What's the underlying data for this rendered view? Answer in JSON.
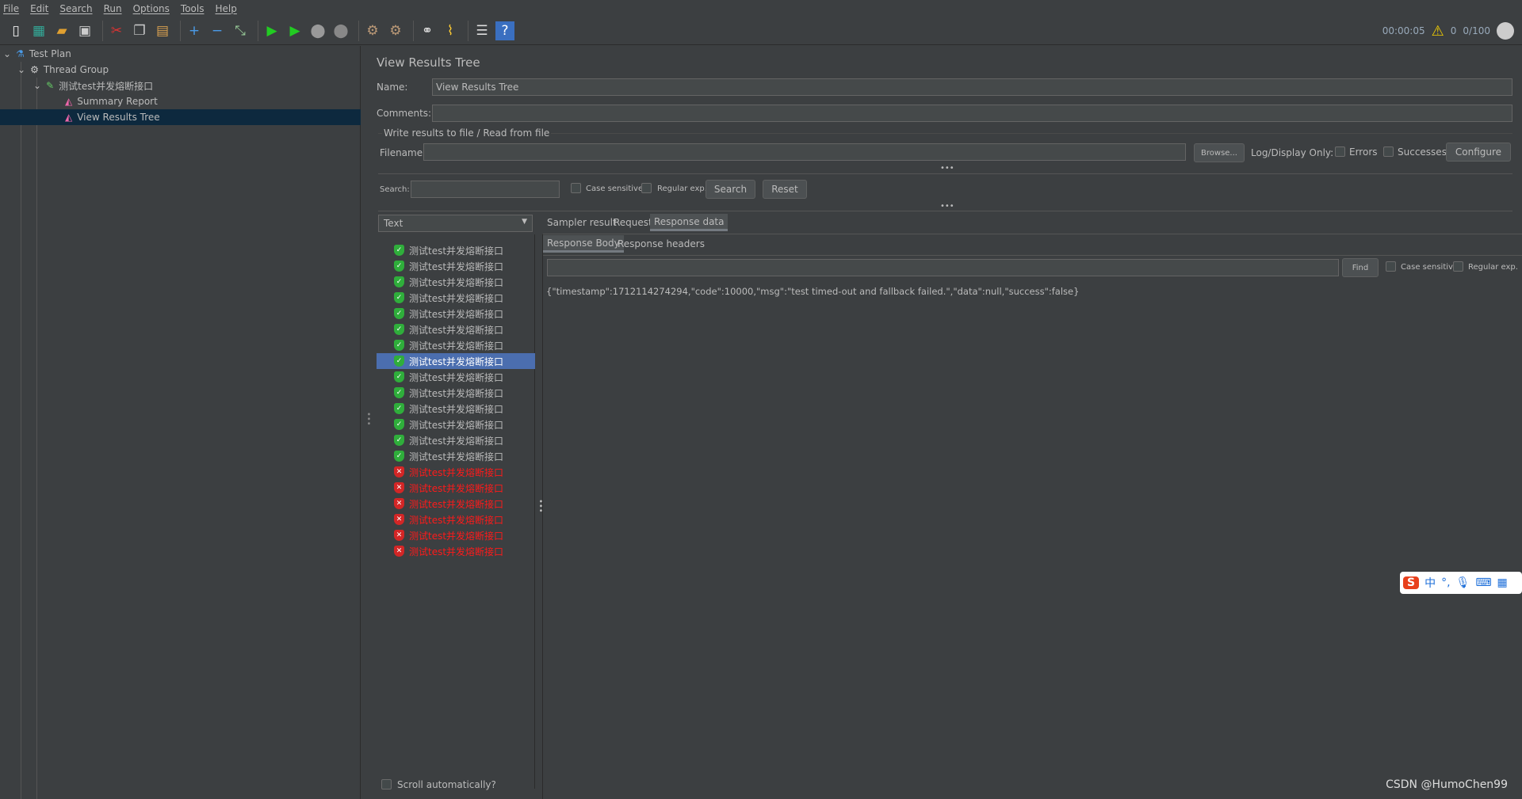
{
  "menu": [
    "File",
    "Edit",
    "Search",
    "Run",
    "Options",
    "Tools",
    "Help"
  ],
  "toolbar": [
    "new-icon",
    "templates-icon",
    "open-icon",
    "save-icon",
    "cut-icon",
    "copy-icon",
    "paste-icon",
    "expand-icon",
    "collapse-icon",
    "toggle-icon",
    "start-icon",
    "start-no-pause-icon",
    "stop-icon",
    "shutdown-icon",
    "clear-icon",
    "clear-all-icon",
    "search-icon",
    "reset-search-icon",
    "function-helper-icon",
    "help-icon"
  ],
  "status": {
    "elapsed": "00:00:05",
    "warnings": "0",
    "threads": "0/100"
  },
  "tree": [
    {
      "label": "Test Plan",
      "icon": "flask-icon"
    },
    {
      "label": "Thread Group",
      "icon": "gear-icon"
    },
    {
      "label": "测试test并发熔断接口",
      "icon": "pipette-icon"
    },
    {
      "label": "Summary Report",
      "icon": "chart-icon"
    },
    {
      "label": "View Results Tree",
      "icon": "chart-icon"
    }
  ],
  "panel": {
    "title": "View Results Tree",
    "name_label": "Name:",
    "name_value": "View Results Tree",
    "comments_label": "Comments:",
    "comments_value": "",
    "group_title": "Write results to file / Read from file",
    "filename_label": "Filename",
    "filename_value": "",
    "browse": "Browse...",
    "log_only": "Log/Display Only:",
    "errors": "Errors",
    "successes": "Successes",
    "configure": "Configure",
    "search_label": "Search:",
    "case_sensitive": "Case sensitive",
    "regular_exp": "Regular exp.",
    "search_btn": "Search",
    "reset_btn": "Reset",
    "renderer": "Text",
    "scroll_auto": "Scroll automatically?"
  },
  "results": {
    "label": "测试test并发熔断接口",
    "statuses": [
      "ok",
      "ok",
      "ok",
      "ok",
      "ok",
      "ok",
      "ok",
      "ok",
      "ok",
      "ok",
      "ok",
      "ok",
      "ok",
      "ok",
      "error",
      "error",
      "error",
      "error",
      "error",
      "error"
    ],
    "selected_index": 7
  },
  "tabs": [
    "Sampler result",
    "Request",
    "Response data"
  ],
  "subtabs": [
    "Response Body",
    "Response headers"
  ],
  "find": {
    "button": "Find",
    "case_sensitive": "Case sensitive",
    "regular_exp": "Regular exp."
  },
  "response_body": "{\"timestamp\":1712114274294,\"code\":10000,\"msg\":\"test timed-out and fallback failed.\",\"data\":null,\"success\":false}",
  "ime": {
    "logo": "S",
    "lang": "中"
  },
  "watermark": "CSDN @HumoChen99",
  "colors": {
    "background": "#3c3f41",
    "selection": "#4b6eaf",
    "tree_selection": "#0d293e",
    "error": "#ff1a1a",
    "success": "#2fae3b"
  }
}
